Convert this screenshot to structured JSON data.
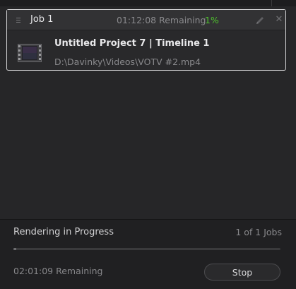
{
  "job": {
    "title": "Job 1",
    "remaining": "01:12:08 Remaining",
    "percent": "1%",
    "percent_color": "#4fc02e",
    "project_name": "Untitled Project 7 | Timeline 1",
    "output_path": "D:\\Davinky\\Videos\\VOTV #2.mp4",
    "icons": {
      "drag": "drag-handle-icon",
      "edit": "pencil-icon",
      "close": "close-icon",
      "thumbnail": "film-strip-icon"
    }
  },
  "status": {
    "label": "Rendering in Progress",
    "job_count": "1 of 1 Jobs",
    "progress": 0.01,
    "remaining": "02:01:09 Remaining",
    "stop_label": "Stop"
  }
}
